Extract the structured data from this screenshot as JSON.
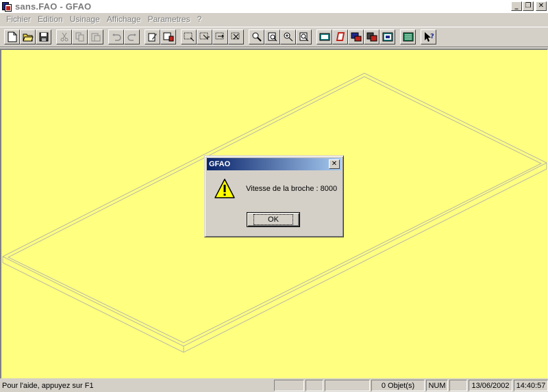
{
  "window": {
    "title": "sans.FAO - GFAO",
    "minimize": "_",
    "restore": "❐",
    "close": "✕"
  },
  "menu": [
    {
      "label": "Fichier"
    },
    {
      "label": "Edition"
    },
    {
      "label": "Usinage"
    },
    {
      "label": "Affichage"
    },
    {
      "label": "Parametres"
    },
    {
      "label": "?"
    }
  ],
  "toolbar": {
    "groups": [
      [
        "new-file-icon",
        "open-folder-icon",
        "save-icon"
      ],
      [
        "cut-icon",
        "copy-icon",
        "paste-icon"
      ],
      [
        "undo-icon",
        "redo-icon"
      ],
      [
        "edit-pencil-icon",
        "properties-icon"
      ],
      [
        "select-box-icon",
        "select-point-icon",
        "select-line-icon",
        "select-delete-icon"
      ],
      [
        "zoom-icon",
        "zoom-window-icon",
        "zoom-in-icon",
        "zoom-all-icon"
      ],
      [
        "view-top-icon",
        "view-shape-icon",
        "machine-icon",
        "save-machine-icon",
        "display-icon"
      ],
      [
        "calculator-icon"
      ],
      [
        "help-pointer-icon"
      ]
    ]
  },
  "dialog": {
    "title": "GFAO",
    "close": "✕",
    "message": "Vitesse de la broche : 8000",
    "ok_label": "OK",
    "icon": "warning-icon"
  },
  "status": {
    "help": "Pour l'aide, appuyez sur F1",
    "objects": "0 Objet(s)",
    "num": "NUM",
    "date": "13/06/2002",
    "time": "14:40:57"
  },
  "colors": {
    "canvas": "#ffff80",
    "dialog_title_start": "#0a246a",
    "dialog_title_end": "#a6caf0"
  }
}
